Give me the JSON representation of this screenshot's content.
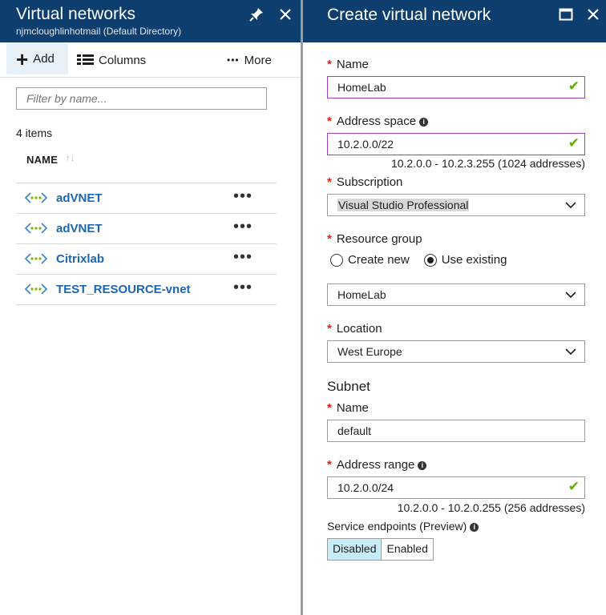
{
  "left_blade": {
    "title": "Virtual networks",
    "subtitle": "njmcloughlinhotmail (Default Directory)",
    "toolbar": {
      "add_label": "Add",
      "columns_label": "Columns",
      "more_label": "More"
    },
    "filter_placeholder": "Filter by name...",
    "item_count": "4 items",
    "column_header": "NAME",
    "items": [
      {
        "name": "adVNET"
      },
      {
        "name": "adVNET"
      },
      {
        "name": "Citrixlab"
      },
      {
        "name": "TEST_RESOURCE-vnet"
      }
    ],
    "row_menu_glyph": "•••"
  },
  "right_blade": {
    "title": "Create virtual network",
    "name": {
      "label": "Name",
      "value": "HomeLab"
    },
    "address_space": {
      "label": "Address space",
      "value": "10.2.0.0/22",
      "hint": "10.2.0.0 - 10.2.3.255 (1024 addresses)"
    },
    "subscription": {
      "label": "Subscription",
      "value": "Visual Studio Professional"
    },
    "resource_group": {
      "label": "Resource group",
      "option_new": "Create new",
      "option_existing": "Use existing",
      "selected": "existing",
      "value": "HomeLab"
    },
    "location": {
      "label": "Location",
      "value": "West Europe"
    },
    "subnet": {
      "heading": "Subnet",
      "name": {
        "label": "Name",
        "value": "default"
      },
      "address_range": {
        "label": "Address range",
        "value": "10.2.0.0/24",
        "hint": "10.2.0.0 - 10.2.0.255 (256 addresses)"
      },
      "service_endpoints": {
        "label": "Service endpoints (Preview)",
        "option_disabled": "Disabled",
        "option_enabled": "Enabled",
        "selected": "Disabled"
      }
    }
  },
  "colors": {
    "header_bg": "#0d3e6e",
    "link_blue": "#1b66b3",
    "required_red": "#e0200f",
    "valid_check": "#5cb000",
    "valid_border": "#9b3fc9",
    "toggle_selected": "#c7ebf7"
  },
  "icons": [
    "pin-icon",
    "close-icon",
    "plus-icon",
    "columns-icon",
    "more-icon",
    "sort-icon",
    "vnet-icon",
    "maximize-icon",
    "info-icon",
    "check-icon",
    "chevron-down-icon"
  ]
}
